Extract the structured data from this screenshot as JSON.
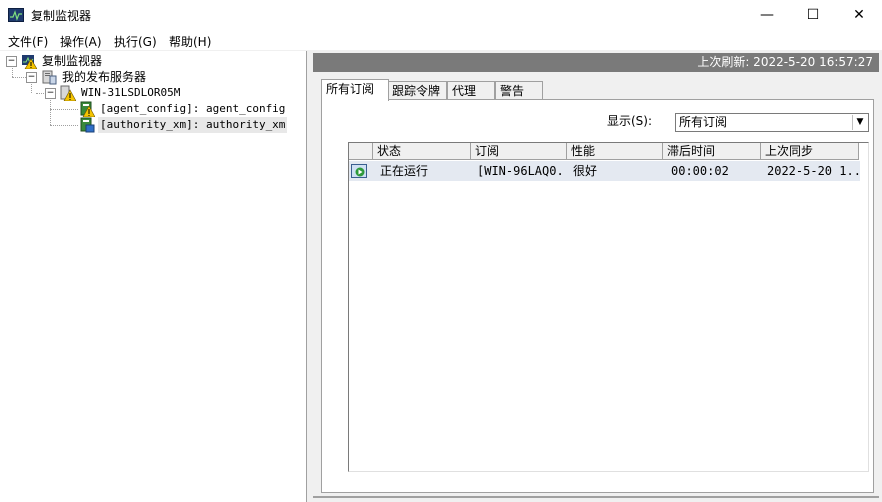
{
  "window": {
    "title": "复制监视器",
    "icon": "monitor-chart-icon",
    "controls": {
      "minimize": "—",
      "maximize": "☐",
      "close": "✕"
    }
  },
  "menu": [
    "文件(F)",
    "操作(A)",
    "执行(G)",
    "帮助(H)"
  ],
  "tree": {
    "root": {
      "label": "复制监视器",
      "expander": "−",
      "icon": "warning-monitor-icon"
    },
    "group": {
      "label": "我的发布服务器",
      "expander": "−",
      "icon": "server-group-icon"
    },
    "server": {
      "label": "WIN-31LSDLOR05M",
      "expander": "−",
      "icon": "warning-server-icon"
    },
    "publications": [
      {
        "label": "[agent_config]: agent_config",
        "icon": "warning-publication-icon"
      },
      {
        "label": "[authority_xm]: authority_xm",
        "icon": "publication-icon"
      }
    ]
  },
  "status": {
    "last_refresh": "上次刷新: 2022-5-20 16:57:27"
  },
  "tabs": [
    "所有订阅",
    "跟踪令牌",
    "代理",
    "警告"
  ],
  "filter": {
    "label": "显示(S):",
    "selected": "所有订阅"
  },
  "grid": {
    "columns": [
      "状态",
      "订阅",
      "性能",
      "滞后时间",
      "上次同步"
    ],
    "rows": [
      {
        "icon": "running-icon",
        "status": "正在运行",
        "subscription": "[WIN-96LAQ0...",
        "performance": "很好",
        "latency": "00:00:02",
        "last_sync": "2022-5-20 1..."
      }
    ]
  },
  "colors": {
    "status_strip": "#7a7a7a",
    "row_highlight": "#e4e9f1",
    "warning": "#f5c400"
  }
}
